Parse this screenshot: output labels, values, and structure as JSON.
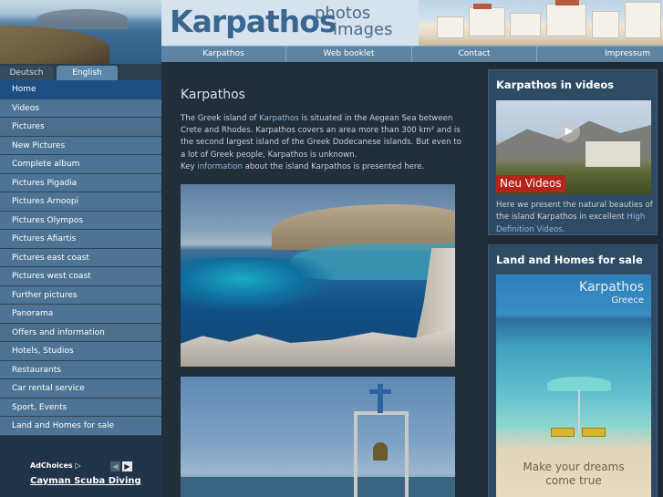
{
  "header": {
    "logo_title": "Karpathos",
    "logo_sub1": "photos",
    "logo_sub2": "images"
  },
  "top_nav": [
    "Karpathos",
    "Web booklet",
    "Contact",
    "Impressum"
  ],
  "languages": {
    "de": "Deutsch",
    "en": "English"
  },
  "sidebar": {
    "items": [
      {
        "label": "Home"
      },
      {
        "label": "Videos"
      },
      {
        "label": "Pictures"
      },
      {
        "label": "New Pictures"
      },
      {
        "label": "Complete album"
      },
      {
        "label": "Pictures Pigadia"
      },
      {
        "label": "Pictures Arnoopi"
      },
      {
        "label": "Pictures Olympos"
      },
      {
        "label": "Pictures Afiartis"
      },
      {
        "label": "Pictures east coast"
      },
      {
        "label": "Pictures west coast"
      },
      {
        "label": "Further pictures"
      },
      {
        "label": "Panorama"
      },
      {
        "label": "Offers and information"
      },
      {
        "label": "Hotels, Studios"
      },
      {
        "label": "Restaurants"
      },
      {
        "label": "Car rental service"
      },
      {
        "label": "Sport, Events"
      },
      {
        "label": "Land and Homes for sale"
      }
    ]
  },
  "ad": {
    "adchoices": "AdChoices ▷",
    "prev": "◀",
    "next": "▶",
    "link": "Cayman Scuba Diving"
  },
  "main": {
    "title": "Karpathos",
    "intro": {
      "p1": "The Greek island of ",
      "link1": "Karpathos",
      "p2": " is situated in the Aegean Sea between Crete and Rhodes. Karpathos covers an area more than 300 km² and is the second largest island of the Greek Dodecanese islands. But even to a lot of Greek people, Karpathos is unknown.",
      "p3": "Key ",
      "link2": "information",
      "p4": " about the island Karpathos is presented here."
    }
  },
  "right": {
    "videos": {
      "title": "Karpathos in videos",
      "badge": "Neu Videos",
      "text1": "Here we present the natural beauties of the island Karpathos in excellent ",
      "link": "High Definition Videos",
      "text2": "."
    },
    "homes": {
      "title": "Land and Homes for sale",
      "brand": "Karpathos",
      "brand_sub": "Greece",
      "slogan1": "Make your dreams",
      "slogan2": "come true"
    }
  }
}
